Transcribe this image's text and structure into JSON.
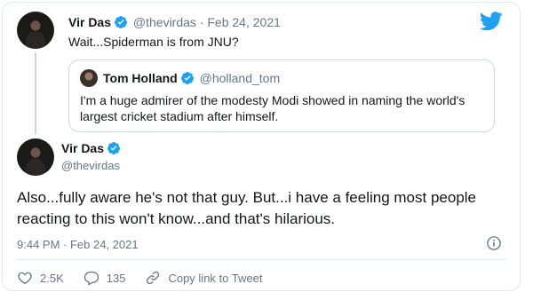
{
  "top_tweet": {
    "name": "Vir Das",
    "handle": "@thevirdas",
    "separator": "·",
    "date": "Feb 24, 2021",
    "text": "Wait...Spiderman is from JNU?"
  },
  "quoted_tweet": {
    "name": "Tom Holland",
    "handle": "@holland_tom",
    "text": "I'm a huge admirer of the modesty Modi showed in naming the world's largest cricket stadium after himself."
  },
  "main_tweet": {
    "name": "Vir Das",
    "handle": "@thevirdas",
    "text": "Also...fully aware he's not that guy. But...i have a feeling most people reacting to this won't know...and that's hilarious.",
    "timestamp": "9:44 PM · Feb 24, 2021"
  },
  "actions": {
    "likes": "2.5K",
    "replies": "135",
    "copy_link": "Copy link to Tweet"
  },
  "icons": {
    "brand": "twitter-bird-icon",
    "verified": "verified-badge-icon",
    "like": "heart-icon",
    "reply": "reply-bubble-icon",
    "link": "link-icon",
    "info": "info-icon"
  },
  "colors": {
    "brand_blue": "#1da1f2",
    "text_primary": "#14171a",
    "text_muted": "#657786",
    "border": "#e1e8ed"
  }
}
